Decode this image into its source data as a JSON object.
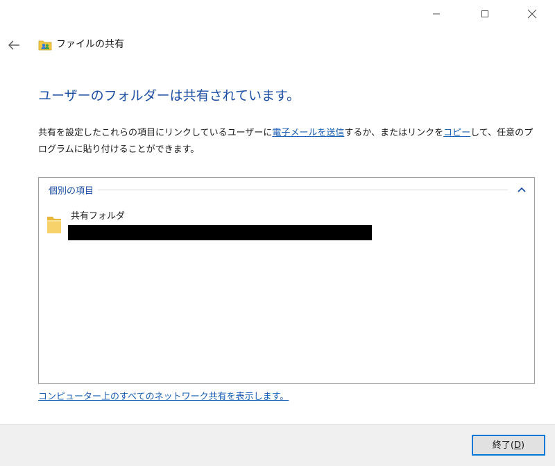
{
  "window": {
    "header_title": "ファイルの共有"
  },
  "main": {
    "heading": "ユーザーのフォルダーは共有されています。",
    "desc_part1": "共有を設定したこれらの項目にリンクしているユーザーに",
    "desc_link_email": "電子メールを送信",
    "desc_part2": "するか、またはリンクを",
    "desc_link_copy": "コピー",
    "desc_part3": "して、任意のプログラムに貼り付けることができます。"
  },
  "items_group": {
    "title": "個別の項目",
    "items": [
      {
        "name": "共有フォルダ"
      }
    ]
  },
  "bottom_link": "コンピューター上のすべてのネットワーク共有を表示します。",
  "footer": {
    "finish_label_pre": "終了(",
    "finish_label_acc": "D",
    "finish_label_post": ")"
  },
  "colors": {
    "heading": "#1e4fa3",
    "link": "#1a5fb4",
    "button_focus": "#0078d7",
    "folder": "#f5c842"
  }
}
